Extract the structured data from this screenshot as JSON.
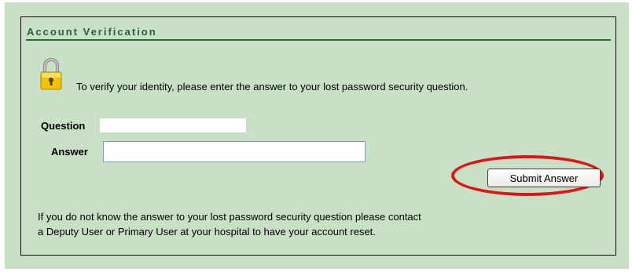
{
  "panel": {
    "title": "Account Verification",
    "lock_icon": "padlock-icon",
    "instructions": "To verify your identity, please enter the answer to your lost password security question."
  },
  "form": {
    "question_label": "Question",
    "question_value": "",
    "answer_label": "Answer",
    "answer_value": "",
    "submit_label": "Submit Answer"
  },
  "footer": {
    "line1": "If you do not know the answer to your lost password security question please contact",
    "line2": "a Deputy User or Primary User at your hospital to have your account reset."
  },
  "colors": {
    "background": "#c8e0c4",
    "header_text": "#2f5f34",
    "highlight_ring": "#e0131a"
  }
}
